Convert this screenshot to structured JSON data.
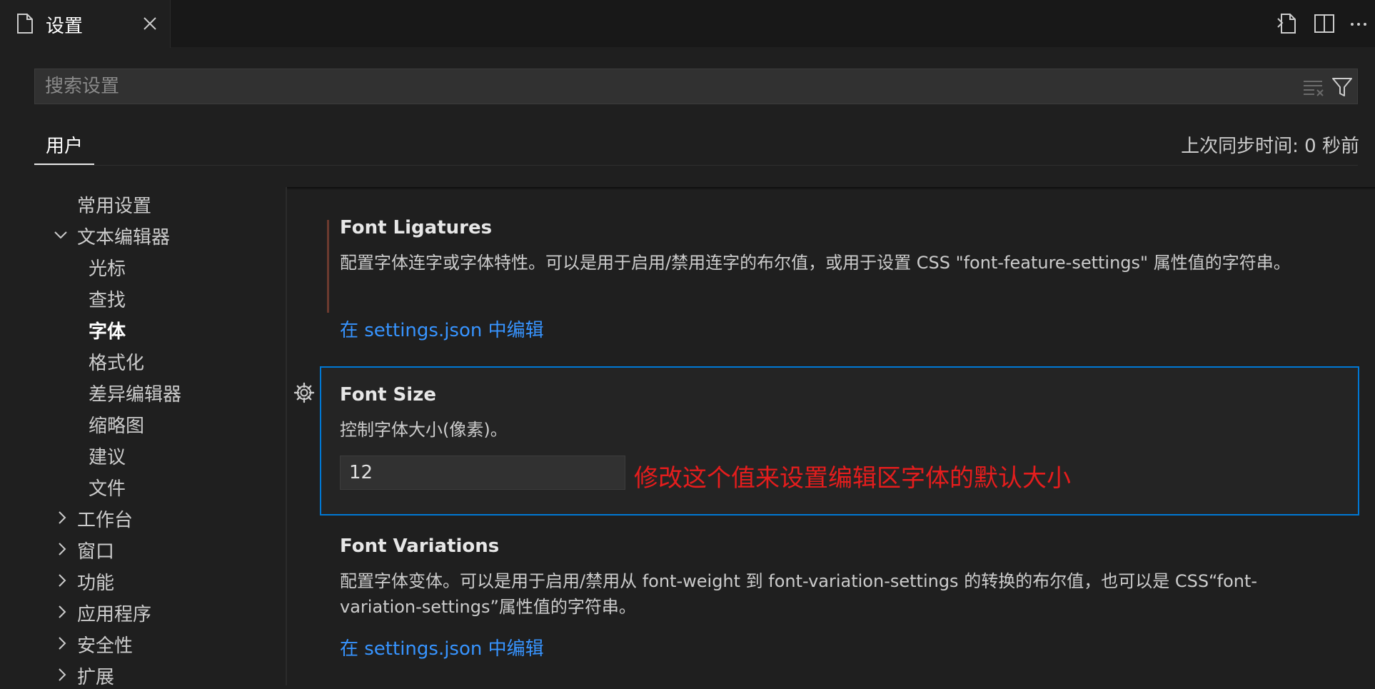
{
  "tab": {
    "label": "设置"
  },
  "search": {
    "placeholder": "搜索设置"
  },
  "scope": {
    "user_tab": "用户",
    "sync_status": "上次同步时间: 0 秒前"
  },
  "toc": {
    "items": [
      {
        "label": "常用设置"
      },
      {
        "label": "文本编辑器"
      },
      {
        "label": "光标"
      },
      {
        "label": "查找"
      },
      {
        "label": "字体"
      },
      {
        "label": "格式化"
      },
      {
        "label": "差异编辑器"
      },
      {
        "label": "缩略图"
      },
      {
        "label": "建议"
      },
      {
        "label": "文件"
      },
      {
        "label": "工作台"
      },
      {
        "label": "窗口"
      },
      {
        "label": "功能"
      },
      {
        "label": "应用程序"
      },
      {
        "label": "安全性"
      },
      {
        "label": "扩展"
      }
    ]
  },
  "settings": [
    {
      "title": "Font Ligatures",
      "description": "配置字体连字或字体特性。可以是用于启用/禁用连字的布尔值，或用于设置 CSS \"font-feature-settings\" 属性值的字符串。",
      "link": "在 settings.json 中编辑"
    },
    {
      "title": "Font Size",
      "description": "控制字体大小(像素)。",
      "value": "12"
    },
    {
      "title": "Font Variations",
      "description": "配置字体变体。可以是用于启用/禁用从 font-weight 到 font-variation-settings 的转换的布尔值，也可以是 CSS“font-variation-settings”属性值的字符串。",
      "link": "在 settings.json 中编辑"
    }
  ],
  "annotation": "修改这个值来设置编辑区字体的默认大小",
  "colors": {
    "accent": "#0078d4",
    "link": "#3794ff",
    "annotation": "#e51d1d",
    "modified_bar": "#6b3a2e"
  }
}
